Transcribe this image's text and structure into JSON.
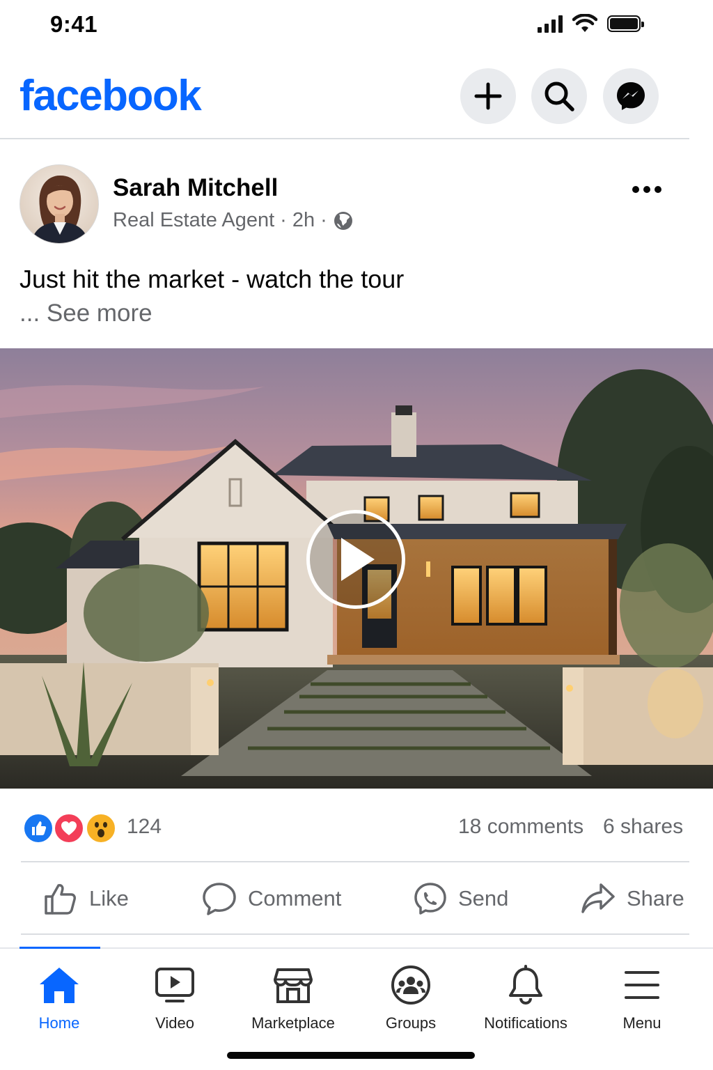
{
  "status_bar": {
    "time": "9:41"
  },
  "header": {
    "logo": "facebook",
    "buttons": [
      {
        "icon": "plus-icon"
      },
      {
        "icon": "search-icon"
      },
      {
        "icon": "messenger-icon"
      }
    ]
  },
  "post": {
    "author": "Sarah Mitchell",
    "subtitle": "Real Estate Agent",
    "time": "2h",
    "separator": "·",
    "audience_icon": "globe-icon",
    "text": "Just hit the market - watch the tour",
    "see_more": "... See more",
    "media": {
      "type": "video",
      "icon": "play-icon"
    },
    "reactions": {
      "icons": [
        "like-reaction-icon",
        "love-reaction-icon",
        "wow-reaction-icon"
      ],
      "count": "124"
    },
    "comments": "18 comments",
    "shares": "6 shares",
    "actions": [
      {
        "label": "Like",
        "icon": "thumbs-up-icon"
      },
      {
        "label": "Comment",
        "icon": "comment-icon"
      },
      {
        "label": "Send",
        "icon": "messenger-send-icon"
      },
      {
        "label": "Share",
        "icon": "share-arrow-icon"
      }
    ]
  },
  "bottom_nav": [
    {
      "label": "Home",
      "icon": "home-icon",
      "active": true
    },
    {
      "label": "Video",
      "icon": "video-icon",
      "active": false
    },
    {
      "label": "Marketplace",
      "icon": "marketplace-icon",
      "active": false
    },
    {
      "label": "Groups",
      "icon": "groups-icon",
      "active": false
    },
    {
      "label": "Notifications",
      "icon": "bell-icon",
      "active": false
    },
    {
      "label": "Menu",
      "icon": "menu-icon",
      "active": false
    }
  ],
  "colors": {
    "brand": "#0866ff",
    "secondary_text": "#65676b",
    "like": "#1877f2",
    "love": "#f33e58",
    "wow": "#f7b125"
  }
}
